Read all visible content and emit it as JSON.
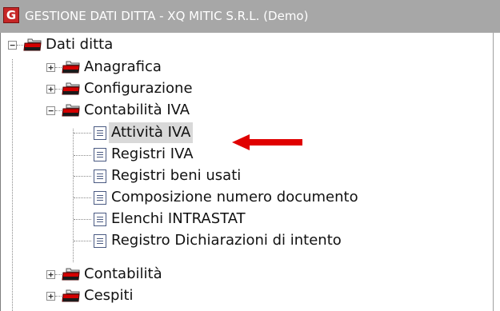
{
  "window": {
    "title": "GESTIONE DATI DITTA - XQ MITIC S.R.L.  (Demo)",
    "app_icon_glyph": "G"
  },
  "tree": {
    "root": {
      "label": "Dati ditta",
      "expander": "−",
      "icon": "folder-icon"
    },
    "children": [
      {
        "label": "Anagrafica",
        "expander": "+",
        "icon": "folder-icon"
      },
      {
        "label": "Configurazione",
        "expander": "+",
        "icon": "folder-icon"
      },
      {
        "label": "Contabilità IVA",
        "expander": "−",
        "icon": "folder-icon",
        "items": [
          {
            "label": "Attività IVA",
            "icon": "document-icon",
            "selected": true
          },
          {
            "label": "Registri IVA",
            "icon": "document-icon"
          },
          {
            "label": "Registri beni usati",
            "icon": "document-icon"
          },
          {
            "label": "Composizione numero documento",
            "icon": "document-icon"
          },
          {
            "label": "Elenchi INTRASTAT",
            "icon": "document-icon"
          },
          {
            "label": "Registro Dichiarazioni di intento",
            "icon": "document-icon"
          }
        ]
      },
      {
        "label": "Contabilità",
        "expander": "+",
        "icon": "folder-icon"
      },
      {
        "label": "Cespiti",
        "expander": "+",
        "icon": "folder-icon"
      }
    ]
  },
  "colors": {
    "titlebar": "#a7a7a7",
    "app_icon": "#c62626",
    "selection_highlight": "#d9d9d9",
    "annotation_arrow": "#e00000"
  }
}
